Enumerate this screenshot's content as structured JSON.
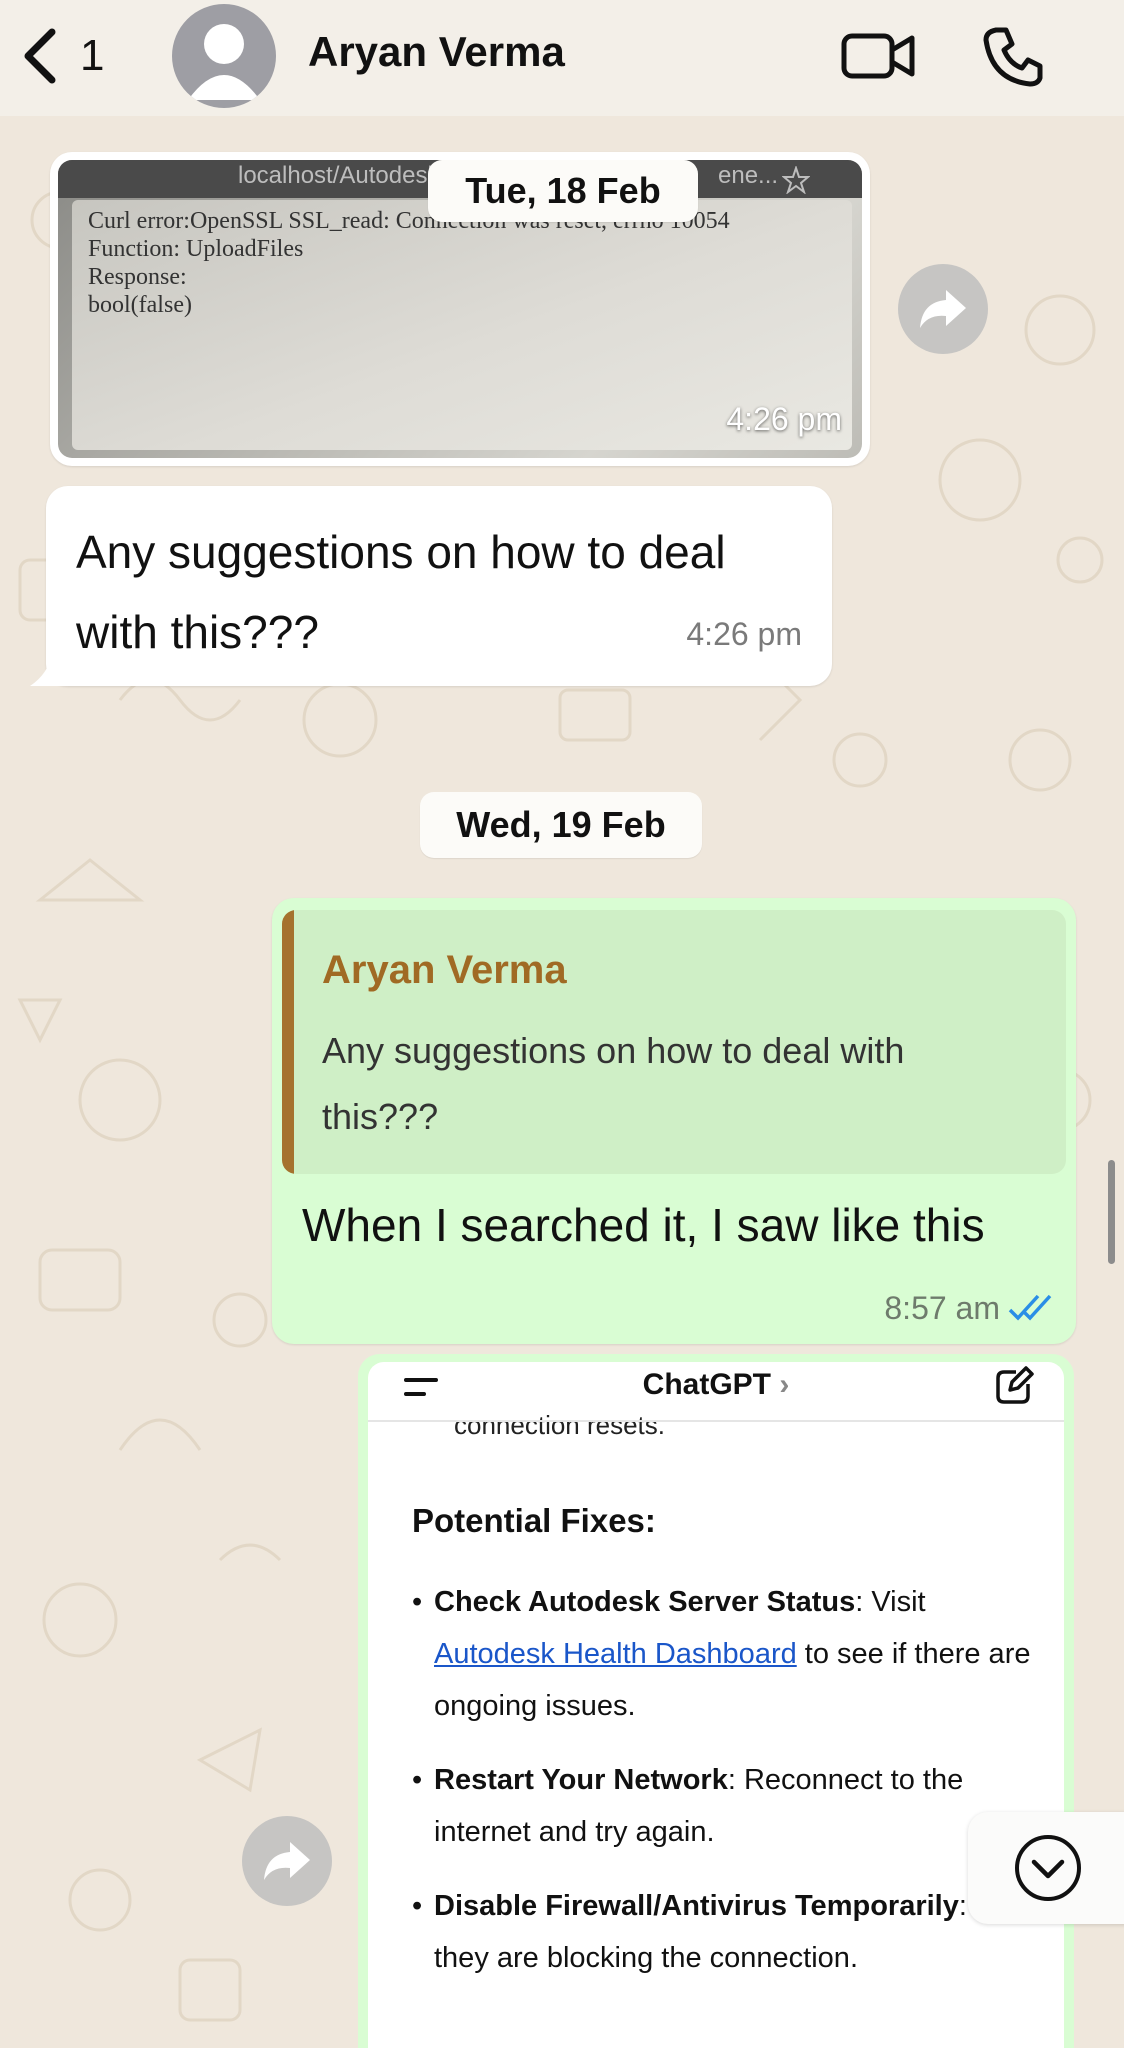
{
  "header": {
    "back_count": "1",
    "contact_name": "Aryan Verma",
    "icons": [
      "chevron-left-icon",
      "avatar",
      "video-call-icon",
      "phone-icon"
    ]
  },
  "messages": {
    "date_1": "Tue, 18 Feb",
    "image_message": {
      "url_fragment": "localhost/Autodesk",
      "url_tail": "ene...",
      "error_lines": [
        "Curl error:OpenSSL SSL_read: Connection was reset, errno 10054",
        "Function: UploadFiles",
        "Response:",
        "bool(false)"
      ],
      "time": "4:26 pm"
    },
    "text_message": {
      "text": "Any suggestions on how to deal with this???",
      "time": "4:26 pm"
    },
    "date_2": "Wed, 19 Feb",
    "reply_message": {
      "quoted_name": "Aryan Verma",
      "quoted_text": "Any suggestions on how to deal with this???",
      "text": "When I searched it, I saw like this",
      "time": "8:57 am",
      "status": "read"
    },
    "screenshot_message": {
      "app_title": "ChatGPT",
      "cut_text": "connection resets.",
      "heading": "Potential Fixes:",
      "items": [
        {
          "bold": "Check Autodesk Server Status",
          "text_before_link": ": Visit ",
          "link": "Autodesk Health Dashboard",
          "text_after_link": " to see if there are ongoing issues."
        },
        {
          "bold": "Restart Your Network",
          "text": ": Reconnect to the internet and try again."
        },
        {
          "bold": "Disable Firewall/Antivirus Temporarily",
          "text": ": See if they are blocking the connection."
        }
      ]
    }
  },
  "colors": {
    "incoming_bubble": "#ffffff",
    "outgoing_bubble": "#d9fdd3",
    "quote_bar": "#a5722e",
    "quote_name": "#a06a24",
    "read_ticks": "#2a8ee6",
    "wallpaper": "#efe7dc"
  }
}
